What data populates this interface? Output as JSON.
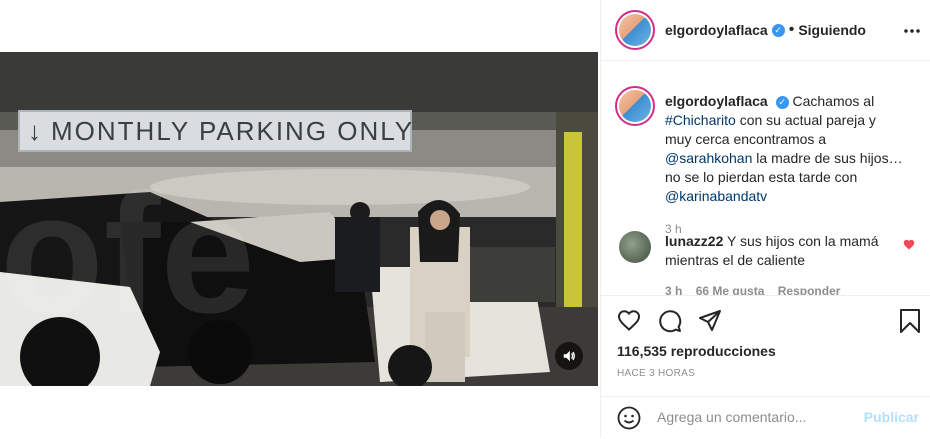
{
  "post": {
    "username": "elgordoylaflaca",
    "separator": "•",
    "follow_status": "Siguiendo",
    "more_icon": "more-options-icon"
  },
  "video": {
    "sign_text": "MONTHLY PARKING ONLY",
    "sign_arrow": "↓",
    "volume_icon": "volume-icon"
  },
  "caption": {
    "username": "elgordoylaflaca",
    "text_1": "Cachamos al",
    "tag_1": "#Chicharito",
    "text_2": "con su actual pareja y muy cerca encontramos a",
    "tag_2": "@sarahkohan",
    "text_3": "la madre de sus hijos… no se lo pierdan esta tarde con",
    "tag_3": "@karinabandatv",
    "time": "3 h"
  },
  "comment": {
    "username": "lunazz22",
    "text": "Y sus hijos con la mamá mientras el de caliente",
    "time": "3 h",
    "likes": "66 Me gusta",
    "reply": "Responder"
  },
  "actions": {
    "views": "116,535 reproducciones",
    "ago": "HACE 3 HORAS"
  },
  "add_comment": {
    "placeholder": "Agrega un comentario...",
    "post_label": "Publicar"
  },
  "colors": {
    "link": "#00376b",
    "verified": "#3897f0",
    "muted": "#8e8e8e",
    "post_disabled": "#b2dffc",
    "heart": "#ed4956"
  }
}
